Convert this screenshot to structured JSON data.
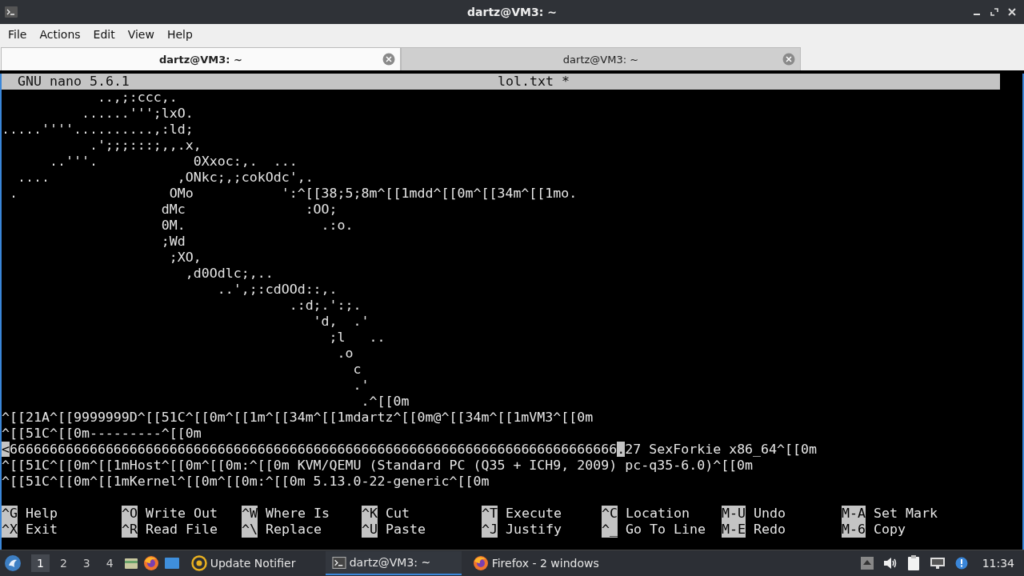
{
  "window": {
    "title": "dartz@VM3: ~"
  },
  "menu": [
    "File",
    "Actions",
    "Edit",
    "View",
    "Help"
  ],
  "tabs": [
    {
      "label": "dartz@VM3: ~",
      "selected": true
    },
    {
      "label": "dartz@VM3: ~",
      "selected": false
    }
  ],
  "nano": {
    "version": "GNU nano 5.6.1",
    "filename": "lol.txt *",
    "lines": [
      {
        "text": "            ..,;:ccc,."
      },
      {
        "text": "          ......''';lxO."
      },
      {
        "text": ".....''''..........,:ld;"
      },
      {
        "text": "           .';;;:::;,,.x,"
      },
      {
        "text": "      ..'''.            0Xxoc:,.  ..."
      },
      {
        "text": "  ....                ,ONkc;,;cokOdc',."
      },
      {
        "text": " .                   OMo           ':^[[38;5;8m^[[1mdd^[[0m^[[34m^[[1mo."
      },
      {
        "text": "                    dMc               :OO;"
      },
      {
        "text": "                    0M.                 .:o."
      },
      {
        "text": "                    ;Wd"
      },
      {
        "text": "                     ;XO,"
      },
      {
        "text": "                       ,d0Odlc;,.."
      },
      {
        "text": "                           ..',;:cdOOd::,."
      },
      {
        "text": "                                    .:d;.':;."
      },
      {
        "text": "                                       'd,  .'"
      },
      {
        "text": "                                         ;l   .."
      },
      {
        "text": "                                          .o"
      },
      {
        "text": "                                            c"
      },
      {
        "text": "                                            .'"
      },
      {
        "text": "                                             .^[[0m"
      },
      {
        "text": "^[[21A^[[9999999D^[[51C^[[0m^[[1m^[[34m^[[1mdartz^[[0m@^[[34m^[[1mVM3^[[0m"
      },
      {
        "text": "^[[51C^[[0m---------^[[0m"
      },
      {
        "segments": [
          {
            "text": "<",
            "highlight": true
          },
          {
            "text": "6666666666666666666666666666666666666666666666666666666666666666666666666666",
            "highlight": false
          },
          {
            "text": ".",
            "highlight": true
          },
          {
            "text": "27 SexForkie x86_64^[[0m",
            "highlight": false
          }
        ]
      },
      {
        "text": "^[[51C^[[0m^[[1mHost^[[0m^[[0m:^[[0m KVM/QEMU (Standard PC (Q35 + ICH9, 2009) pc-q35-6.0)^[[0m"
      },
      {
        "text": "^[[51C^[[0m^[[1mKernel^[[0m^[[0m:^[[0m 5.13.0-22-generic^[[0m"
      }
    ],
    "shortcuts": [
      [
        {
          "key": "^G",
          "label": "Help"
        },
        {
          "key": "^X",
          "label": "Exit"
        }
      ],
      [
        {
          "key": "^O",
          "label": "Write Out"
        },
        {
          "key": "^R",
          "label": "Read File"
        }
      ],
      [
        {
          "key": "^W",
          "label": "Where Is"
        },
        {
          "key": "^\\",
          "label": "Replace"
        }
      ],
      [
        {
          "key": "^K",
          "label": "Cut"
        },
        {
          "key": "^U",
          "label": "Paste"
        }
      ],
      [
        {
          "key": "^T",
          "label": "Execute"
        },
        {
          "key": "^J",
          "label": "Justify"
        }
      ],
      [
        {
          "key": "^C",
          "label": "Location"
        },
        {
          "key": "^_",
          "label": "Go To Line"
        }
      ],
      [
        {
          "key": "M-U",
          "label": "Undo"
        },
        {
          "key": "M-E",
          "label": "Redo"
        }
      ],
      [
        {
          "key": "M-A",
          "label": "Set Mark"
        },
        {
          "key": "M-6",
          "label": "Copy"
        }
      ]
    ]
  },
  "taskbar": {
    "workspaces": [
      {
        "label": "1",
        "selected": true
      },
      {
        "label": "2",
        "selected": false
      },
      {
        "label": "3",
        "selected": false
      },
      {
        "label": "4",
        "selected": false
      }
    ],
    "tasks": [
      {
        "kind": "notifier",
        "label": "Update Notifier",
        "selected": false
      },
      {
        "kind": "terminal",
        "label": "dartz@VM3: ~",
        "selected": true
      },
      {
        "kind": "firefox",
        "label": "Firefox - 2 windows",
        "selected": false
      }
    ],
    "clock": "11:34"
  }
}
